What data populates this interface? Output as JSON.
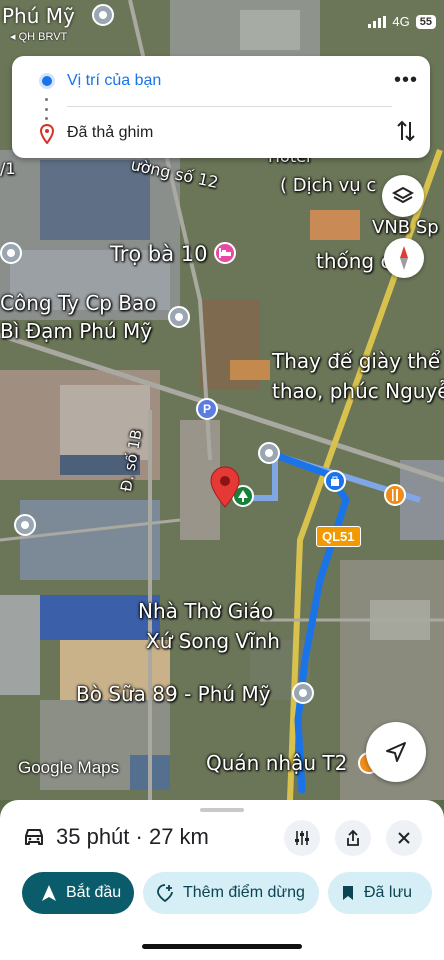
{
  "status_bar": {
    "time": "Phú Mỹ",
    "back_app": "◂ QH BRVT",
    "network": "4G",
    "battery": "55"
  },
  "route_card": {
    "origin": "Vị trí của bạn",
    "destination": "Đã thả ghim",
    "more_icon": "more-vert-icon",
    "swap_icon": "swap-vertical-icon"
  },
  "map": {
    "labels": {
      "road_12": "ường số 12",
      "service": "( Dịch vụ c",
      "hotel": "Hotel",
      "tro_ba": "Trọ bà 10",
      "vnb": "VNB Sp",
      "thong": "thống c",
      "cong_ty_1": "Công Ty Cp Bao",
      "cong_ty_2": "Bì Đạm Phú Mỹ",
      "thay_de_1": "Thay đế giày thể",
      "thay_de_2": "thao, phúc Nguyễn",
      "road_1b": "Đ. số 1B",
      "ql51": "QL51",
      "nha_tho_1": "Nhà Thờ Giáo",
      "nha_tho_2": "Xứ Song Vĩnh",
      "bo_sua": "Bò Sữa 89 - Phú Mỹ",
      "quan_nhau": "Quán nhậu T2",
      "top_left": "1",
      "left_edge": "/1"
    },
    "logo": "Google Maps",
    "accent_route": "#1a73e8"
  },
  "bottom_sheet": {
    "duration": "35 phút · 27 km",
    "start": "Bắt đầu",
    "add_stop": "Thêm điểm dừng",
    "saved": "Đã lưu"
  }
}
